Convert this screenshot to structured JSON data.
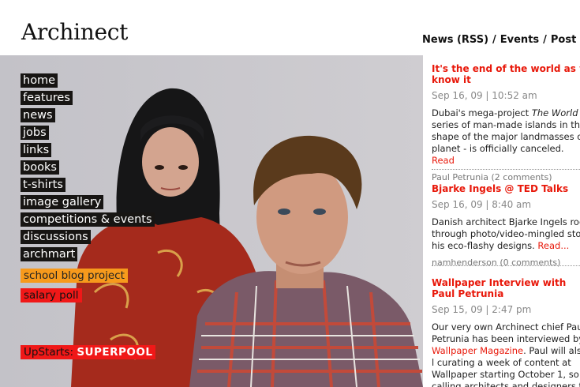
{
  "site": {
    "logo": "Archinect"
  },
  "topnav": {
    "news_rss": "News (RSS)",
    "sep1": "/",
    "events": "Events",
    "sep2": "/",
    "post": "Post"
  },
  "menu": {
    "home": "home",
    "features": "features",
    "news": "news",
    "jobs": "jobs",
    "links": "links",
    "books": "books",
    "tshirts": "t-shirts",
    "image_gallery": "image gallery",
    "competitions": "competitions & events",
    "discussions": "discussions",
    "archmart": "archmart",
    "school_blog": "school blog project",
    "salary_poll": "salary poll",
    "upstarts_prefix": "UpStarts:",
    "upstarts_name": "SUPERPOOL"
  },
  "posts": [
    {
      "title": "It's the end of the world as we know it",
      "meta": "Sep 16, 09 | 10:52 am",
      "body_a": "Dubai's mega-project ",
      "body_em": "The World",
      "body_b": " - series of man-made islands in the shape of the major landmasses on planet - is officially canceled. ",
      "read": "Read",
      "author": "Paul Petrunia (2 comments)"
    },
    {
      "title": "Bjarke Ingels @ TED Talks",
      "meta": "Sep 16, 09 | 8:40 am",
      "body_a": "Danish architect Bjarke Ingels roc through photo/video-mingled stor his eco-flashy designs. ",
      "read": "Read...",
      "author": "namhenderson (0 comments)"
    },
    {
      "title": "Wallpaper Interview with Paul Petrunia",
      "meta": "Sep 15, 09 | 2:47 pm",
      "body_a": "Our very own Archinect chief Paul Petrunia has been interviewed by ",
      "link": "Wallpaper Magazine",
      "body_b": ". Paul will also l curating a week of content at Wallpaper starting October 1, so w calling architects and designers t"
    }
  ],
  "colors": {
    "accent_red": "#e8180a",
    "menu_bg": "#171513",
    "orange": "#f79a1c",
    "red_badge": "#f01818"
  }
}
